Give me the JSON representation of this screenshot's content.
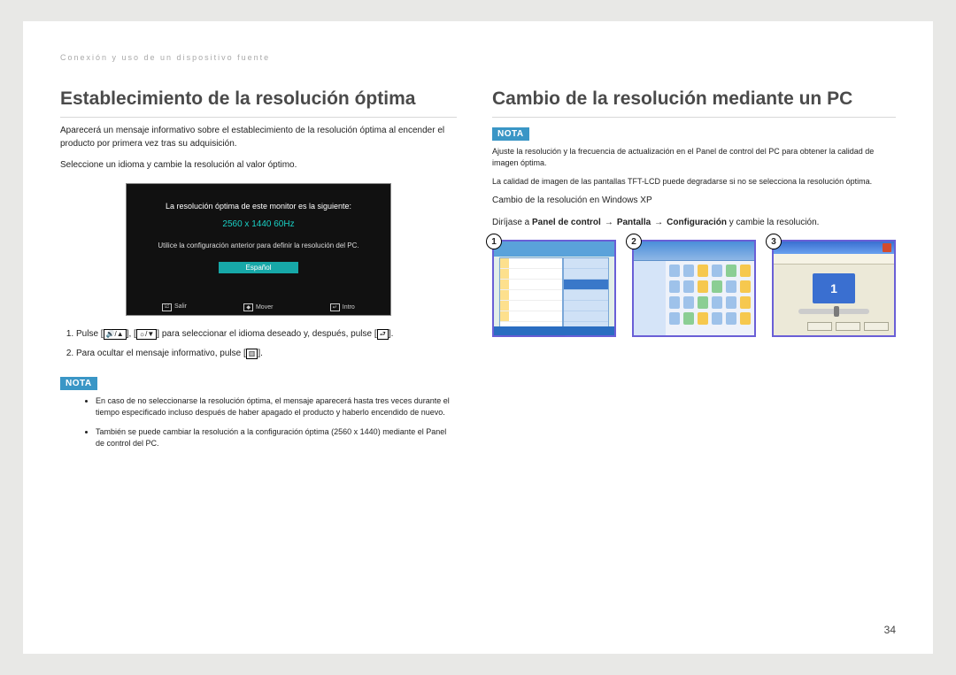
{
  "breadcrumb": "Conexión y uso de un dispositivo fuente",
  "page_number": "34",
  "left": {
    "heading": "Establecimiento de la resolución óptima",
    "p1": "Aparecerá un mensaje informativo sobre el establecimiento de la resolución óptima al encender el producto por primera vez tras su adquisición.",
    "p2": "Seleccione un idioma y cambie la resolución al valor óptimo.",
    "osd": {
      "title": "La resolución óptima de este monitor es la siguiente:",
      "res": "2560 x 1440  60Hz",
      "sub": "Utilice la configuración anterior para definir la resolución del PC.",
      "lang": "Español",
      "foot1": "Salir",
      "foot2": "Mover",
      "foot3": "Intro"
    },
    "step1_a": "Pulse [",
    "step1_b": "] para seleccionar el idioma deseado y, después, pulse [",
    "step1_c": "].",
    "step2_a": "Para ocultar el mensaje informativo, pulse [",
    "step2_b": "].",
    "nota_label": "NOTA",
    "note1": "En caso de no seleccionarse la resolución óptima, el mensaje aparecerá hasta tres veces durante el tiempo especificado incluso después de haber apagado el producto y haberlo encendido de nuevo.",
    "note2": "También se puede cambiar la resolución a la configuración óptima (2560 x 1440) mediante el Panel de control del PC."
  },
  "right": {
    "heading": "Cambio de la resolución mediante un PC",
    "nota_label": "NOTA",
    "note_p1": "Ajuste la resolución y la frecuencia de actualización en el Panel de control del PC para obtener la calidad de imagen óptima.",
    "note_p2": "La calidad de imagen de las pantallas TFT-LCD puede degradarse si no se selecciona la resolución óptima.",
    "sub": "Cambio de la resolución en Windows XP",
    "nav_pre": "Diríjase a ",
    "nav_1": "Panel de control",
    "nav_2": "Pantalla",
    "nav_3": "Configuración",
    "nav_post": " y cambie la resolución.",
    "thumb1": "1",
    "thumb2": "2",
    "thumb3": "3",
    "mon_num": "1"
  }
}
